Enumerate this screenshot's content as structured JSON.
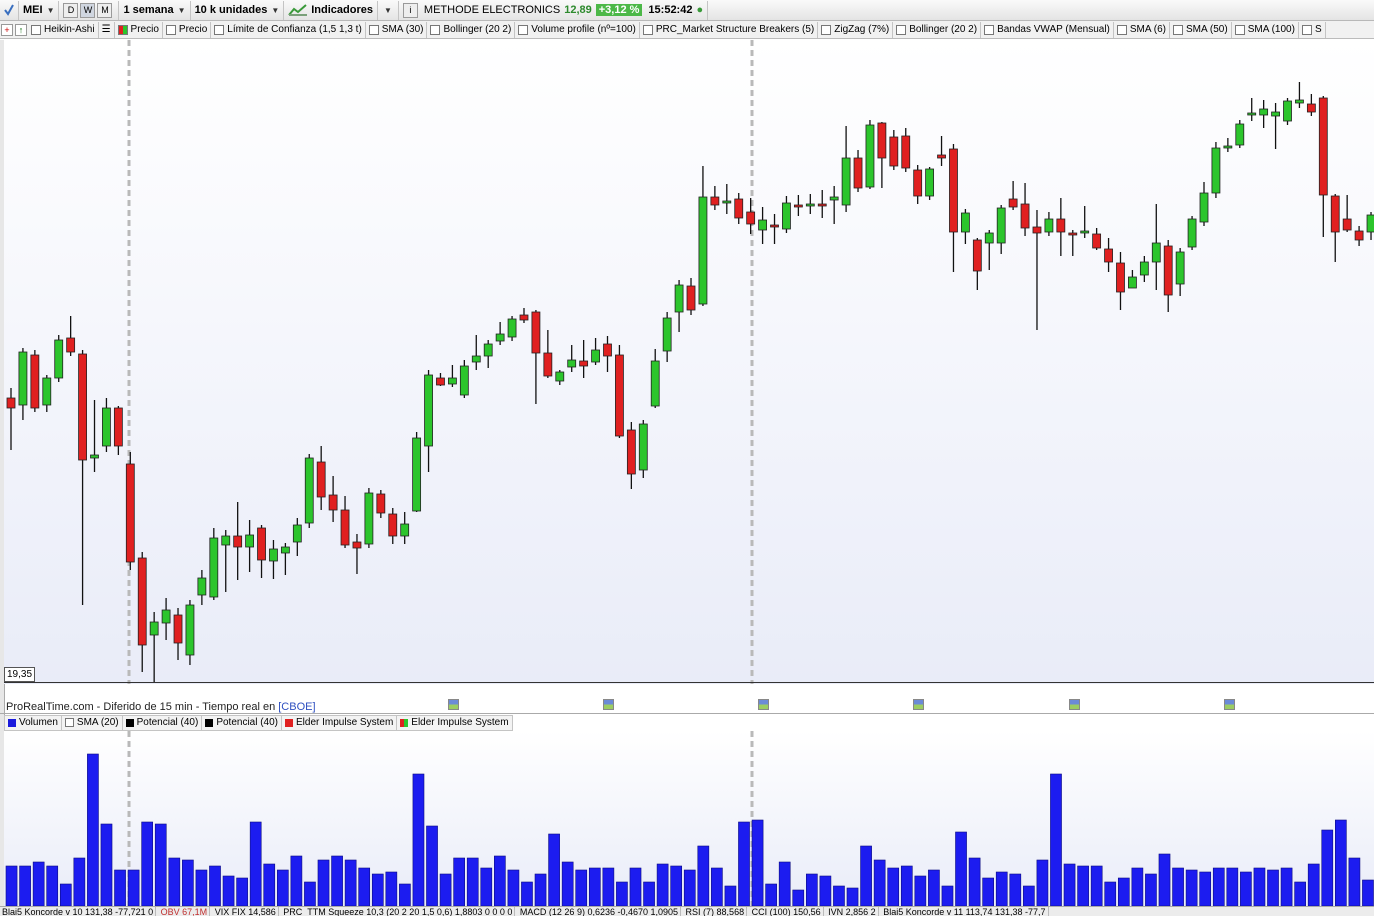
{
  "toolbar": {
    "symbol": "MEI",
    "period_buttons": [
      "D",
      "W",
      "M"
    ],
    "selected_period": "W",
    "timeframe": "1 semana",
    "units": "10 k unidades",
    "indicators_label": "Indicadores",
    "info_symbol": "i",
    "instrument_name": "METHODE ELECTRONICS",
    "last_price": "12,89",
    "change_pct": "+3,12 %",
    "time": "15:52:42",
    "change_color": "#4cb848"
  },
  "indicator_bar": {
    "items": [
      "Heikin-Ashi",
      "Precio",
      "Precio",
      "Límite de Confianza (1,5 1,3 t)",
      "SMA (30)",
      "Bollinger (20 2)",
      "Volume profile (nº=100)",
      "PRC_Market Structure Breakers (5)",
      "ZigZag (7%)",
      "Bollinger (20 2)",
      "Bandas VWAP  (Mensual)",
      "SMA (6)",
      "SMA (50)",
      "SMA (100)",
      "S"
    ]
  },
  "price_chart": {
    "price_label": "19,35",
    "source_text": "ProRealTime.com - Diferido de 15 min - Tiempo real en ",
    "source_link": "[CBOE]",
    "up_color": "#2cc52c",
    "down_color": "#e02020"
  },
  "volume_panel": {
    "indicators": [
      {
        "label": "Volumen",
        "color": "#1a1adc"
      },
      {
        "label": "SMA (20)",
        "color": "#ffffff"
      },
      {
        "label": "Potencial (40)",
        "color": "#000000"
      },
      {
        "label": "Potencial (40)",
        "color": "#000000"
      },
      {
        "label": "Elder Impulse System",
        "color": "#e02020"
      },
      {
        "label": "Elder Impulse System",
        "color": "#2cc52c"
      }
    ],
    "bar_color": "#1c1cf0"
  },
  "bottom_indicators": {
    "items": [
      "Blai5 Koncorde v 10  131,38  -77,721  0",
      "OBV  67,1M",
      "VIX FIX  14,586",
      "PRC_TTM Squeeze  10,3 (20 2 20 1,5 0,6)  1,8803  0  0  0  0",
      "MACD (12 26 9)  0,6236  -0,4670  1,0905",
      "RSI (7)  88,568",
      "CCI (100)  150,56",
      "IVN  2,856 2",
      "Blai5 Koncorde v 11  113,74  131,38  -77,7"
    ]
  },
  "chart_data": {
    "type": "candlestick",
    "candles": [
      {
        "o": 398,
        "c": 408,
        "h": 388,
        "l": 450
      },
      {
        "o": 405,
        "c": 352,
        "h": 348,
        "l": 420
      },
      {
        "o": 355,
        "c": 408,
        "h": 350,
        "l": 412
      },
      {
        "o": 405,
        "c": 378,
        "h": 375,
        "l": 412
      },
      {
        "o": 378,
        "c": 340,
        "h": 335,
        "l": 382
      },
      {
        "o": 338,
        "c": 352,
        "h": 316,
        "l": 356
      },
      {
        "o": 354,
        "c": 460,
        "h": 350,
        "l": 605
      },
      {
        "o": 458,
        "c": 455,
        "h": 400,
        "l": 472
      },
      {
        "o": 446,
        "c": 408,
        "h": 398,
        "l": 452
      },
      {
        "o": 408,
        "c": 446,
        "h": 406,
        "l": 455
      },
      {
        "o": 464,
        "c": 562,
        "h": 452,
        "l": 570
      },
      {
        "o": 558,
        "c": 645,
        "h": 552,
        "l": 672
      },
      {
        "o": 635,
        "c": 622,
        "h": 612,
        "l": 682
      },
      {
        "o": 623,
        "c": 610,
        "h": 598,
        "l": 640
      },
      {
        "o": 615,
        "c": 643,
        "h": 608,
        "l": 660
      },
      {
        "o": 655,
        "c": 605,
        "h": 600,
        "l": 665
      },
      {
        "o": 595,
        "c": 578,
        "h": 570,
        "l": 605
      },
      {
        "o": 597,
        "c": 538,
        "h": 528,
        "l": 600
      },
      {
        "o": 545,
        "c": 536,
        "h": 530,
        "l": 592
      },
      {
        "o": 536,
        "c": 547,
        "h": 502,
        "l": 580
      },
      {
        "o": 547,
        "c": 535,
        "h": 520,
        "l": 572
      },
      {
        "o": 528,
        "c": 560,
        "h": 525,
        "l": 578
      },
      {
        "o": 561,
        "c": 549,
        "h": 540,
        "l": 579
      },
      {
        "o": 553,
        "c": 547,
        "h": 543,
        "l": 575
      },
      {
        "o": 542,
        "c": 525,
        "h": 518,
        "l": 556
      },
      {
        "o": 523,
        "c": 458,
        "h": 454,
        "l": 528
      },
      {
        "o": 462,
        "c": 497,
        "h": 446,
        "l": 510
      },
      {
        "o": 495,
        "c": 510,
        "h": 476,
        "l": 522
      },
      {
        "o": 510,
        "c": 545,
        "h": 496,
        "l": 548
      },
      {
        "o": 542,
        "c": 548,
        "h": 534,
        "l": 574
      },
      {
        "o": 544,
        "c": 493,
        "h": 488,
        "l": 548
      },
      {
        "o": 494,
        "c": 513,
        "h": 490,
        "l": 518
      },
      {
        "o": 514,
        "c": 536,
        "h": 508,
        "l": 544
      },
      {
        "o": 536,
        "c": 524,
        "h": 512,
        "l": 544
      },
      {
        "o": 511,
        "c": 438,
        "h": 432,
        "l": 512
      },
      {
        "o": 446,
        "c": 375,
        "h": 370,
        "l": 472
      },
      {
        "o": 378,
        "c": 385,
        "h": 373,
        "l": 386
      },
      {
        "o": 384,
        "c": 378,
        "h": 365,
        "l": 387
      },
      {
        "o": 395,
        "c": 366,
        "h": 360,
        "l": 398
      },
      {
        "o": 362,
        "c": 356,
        "h": 335,
        "l": 370
      },
      {
        "o": 356,
        "c": 344,
        "h": 340,
        "l": 368
      },
      {
        "o": 341,
        "c": 334,
        "h": 322,
        "l": 345
      },
      {
        "o": 337,
        "c": 319,
        "h": 316,
        "l": 341
      },
      {
        "o": 315,
        "c": 320,
        "h": 308,
        "l": 323
      },
      {
        "o": 312,
        "c": 353,
        "h": 310,
        "l": 404
      },
      {
        "o": 353,
        "c": 376,
        "h": 330,
        "l": 378
      },
      {
        "o": 381,
        "c": 372,
        "h": 370,
        "l": 385
      },
      {
        "o": 367,
        "c": 360,
        "h": 345,
        "l": 372
      },
      {
        "o": 361,
        "c": 366,
        "h": 340,
        "l": 378
      },
      {
        "o": 362,
        "c": 350,
        "h": 338,
        "l": 365
      },
      {
        "o": 344,
        "c": 356,
        "h": 336,
        "l": 372
      },
      {
        "o": 355,
        "c": 436,
        "h": 345,
        "l": 438
      },
      {
        "o": 430,
        "c": 474,
        "h": 422,
        "l": 489
      },
      {
        "o": 470,
        "c": 424,
        "h": 420,
        "l": 478
      },
      {
        "o": 406,
        "c": 361,
        "h": 349,
        "l": 408
      },
      {
        "o": 351,
        "c": 318,
        "h": 312,
        "l": 362
      },
      {
        "o": 312,
        "c": 285,
        "h": 280,
        "l": 332
      },
      {
        "o": 286,
        "c": 310,
        "h": 278,
        "l": 315
      },
      {
        "o": 304,
        "c": 197,
        "h": 166,
        "l": 306
      },
      {
        "o": 197,
        "c": 205,
        "h": 186,
        "l": 210
      },
      {
        "o": 203,
        "c": 201,
        "h": 184,
        "l": 214
      },
      {
        "o": 199,
        "c": 218,
        "h": 193,
        "l": 224
      },
      {
        "o": 212,
        "c": 224,
        "h": 198,
        "l": 234
      },
      {
        "o": 230,
        "c": 220,
        "h": 207,
        "l": 244
      },
      {
        "o": 225,
        "c": 226,
        "h": 214,
        "l": 244
      },
      {
        "o": 229,
        "c": 203,
        "h": 196,
        "l": 233
      },
      {
        "o": 205,
        "c": 207,
        "h": 195,
        "l": 216
      },
      {
        "o": 205,
        "c": 204,
        "h": 194,
        "l": 214
      },
      {
        "o": 204,
        "c": 206,
        "h": 190,
        "l": 218
      },
      {
        "o": 200,
        "c": 197,
        "h": 186,
        "l": 224
      },
      {
        "o": 205,
        "c": 158,
        "h": 126,
        "l": 212
      },
      {
        "o": 158,
        "c": 188,
        "h": 150,
        "l": 192
      },
      {
        "o": 187,
        "c": 125,
        "h": 120,
        "l": 189
      },
      {
        "o": 123,
        "c": 158,
        "h": 122,
        "l": 188
      },
      {
        "o": 137,
        "c": 166,
        "h": 130,
        "l": 170
      },
      {
        "o": 136,
        "c": 168,
        "h": 128,
        "l": 172
      },
      {
        "o": 170,
        "c": 196,
        "h": 165,
        "l": 204
      },
      {
        "o": 196,
        "c": 169,
        "h": 167,
        "l": 200
      },
      {
        "o": 155,
        "c": 158,
        "h": 136,
        "l": 166
      },
      {
        "o": 149,
        "c": 232,
        "h": 144,
        "l": 272
      },
      {
        "o": 232,
        "c": 213,
        "h": 209,
        "l": 244
      },
      {
        "o": 240,
        "c": 271,
        "h": 238,
        "l": 290
      },
      {
        "o": 243,
        "c": 233,
        "h": 230,
        "l": 270
      },
      {
        "o": 243,
        "c": 208,
        "h": 205,
        "l": 254
      },
      {
        "o": 199,
        "c": 207,
        "h": 181,
        "l": 210
      },
      {
        "o": 204,
        "c": 228,
        "h": 183,
        "l": 236
      },
      {
        "o": 227,
        "c": 233,
        "h": 210,
        "l": 330
      },
      {
        "o": 232,
        "c": 219,
        "h": 212,
        "l": 236
      },
      {
        "o": 219,
        "c": 232,
        "h": 198,
        "l": 256
      },
      {
        "o": 233,
        "c": 234,
        "h": 230,
        "l": 256
      },
      {
        "o": 232,
        "c": 231,
        "h": 206,
        "l": 238
      },
      {
        "o": 234,
        "c": 248,
        "h": 228,
        "l": 250
      },
      {
        "o": 249,
        "c": 262,
        "h": 238,
        "l": 272
      },
      {
        "o": 263,
        "c": 292,
        "h": 252,
        "l": 310
      },
      {
        "o": 288,
        "c": 277,
        "h": 270,
        "l": 288
      },
      {
        "o": 275,
        "c": 262,
        "h": 256,
        "l": 282
      },
      {
        "o": 262,
        "c": 243,
        "h": 204,
        "l": 290
      },
      {
        "o": 246,
        "c": 295,
        "h": 240,
        "l": 312
      },
      {
        "o": 284,
        "c": 252,
        "h": 248,
        "l": 296
      },
      {
        "o": 247,
        "c": 219,
        "h": 216,
        "l": 250
      },
      {
        "o": 222,
        "c": 193,
        "h": 182,
        "l": 226
      },
      {
        "o": 193,
        "c": 148,
        "h": 142,
        "l": 198
      },
      {
        "o": 148,
        "c": 146,
        "h": 138,
        "l": 152
      },
      {
        "o": 145,
        "c": 124,
        "h": 120,
        "l": 148
      },
      {
        "o": 114,
        "c": 113,
        "h": 98,
        "l": 121
      },
      {
        "o": 115,
        "c": 109,
        "h": 100,
        "l": 128
      },
      {
        "o": 116,
        "c": 112,
        "h": 103,
        "l": 149
      },
      {
        "o": 121,
        "c": 101,
        "h": 98,
        "l": 125
      },
      {
        "o": 103,
        "c": 100,
        "h": 82,
        "l": 108
      },
      {
        "o": 104,
        "c": 112,
        "h": 94,
        "l": 116
      },
      {
        "o": 98,
        "c": 195,
        "h": 96,
        "l": 237
      },
      {
        "o": 196,
        "c": 232,
        "h": 194,
        "l": 262
      },
      {
        "o": 219,
        "c": 230,
        "h": 195,
        "l": 232
      },
      {
        "o": 231,
        "c": 240,
        "h": 226,
        "l": 246
      },
      {
        "o": 232,
        "c": 215,
        "h": 212,
        "l": 240
      }
    ],
    "volume": [
      40,
      40,
      44,
      40,
      22,
      48,
      152,
      82,
      36,
      36,
      84,
      82,
      48,
      46,
      36,
      40,
      30,
      28,
      84,
      42,
      36,
      50,
      24,
      46,
      50,
      46,
      38,
      32,
      34,
      22,
      132,
      80,
      32,
      48,
      48,
      38,
      50,
      36,
      24,
      32,
      72,
      44,
      36,
      38,
      38,
      24,
      38,
      24,
      42,
      40,
      36,
      60,
      38,
      20,
      84,
      86,
      22,
      44,
      16,
      32,
      30,
      20,
      18,
      60,
      46,
      38,
      40,
      30,
      36,
      20,
      74,
      48,
      28,
      34,
      32,
      20,
      46,
      132,
      42,
      40,
      40,
      24,
      28,
      38,
      32,
      52,
      38,
      36,
      34,
      38,
      38,
      34,
      38,
      36,
      38,
      24,
      42,
      76,
      86,
      48,
      26
    ],
    "price_label_value": "19,35",
    "vertical_markers": 2
  }
}
